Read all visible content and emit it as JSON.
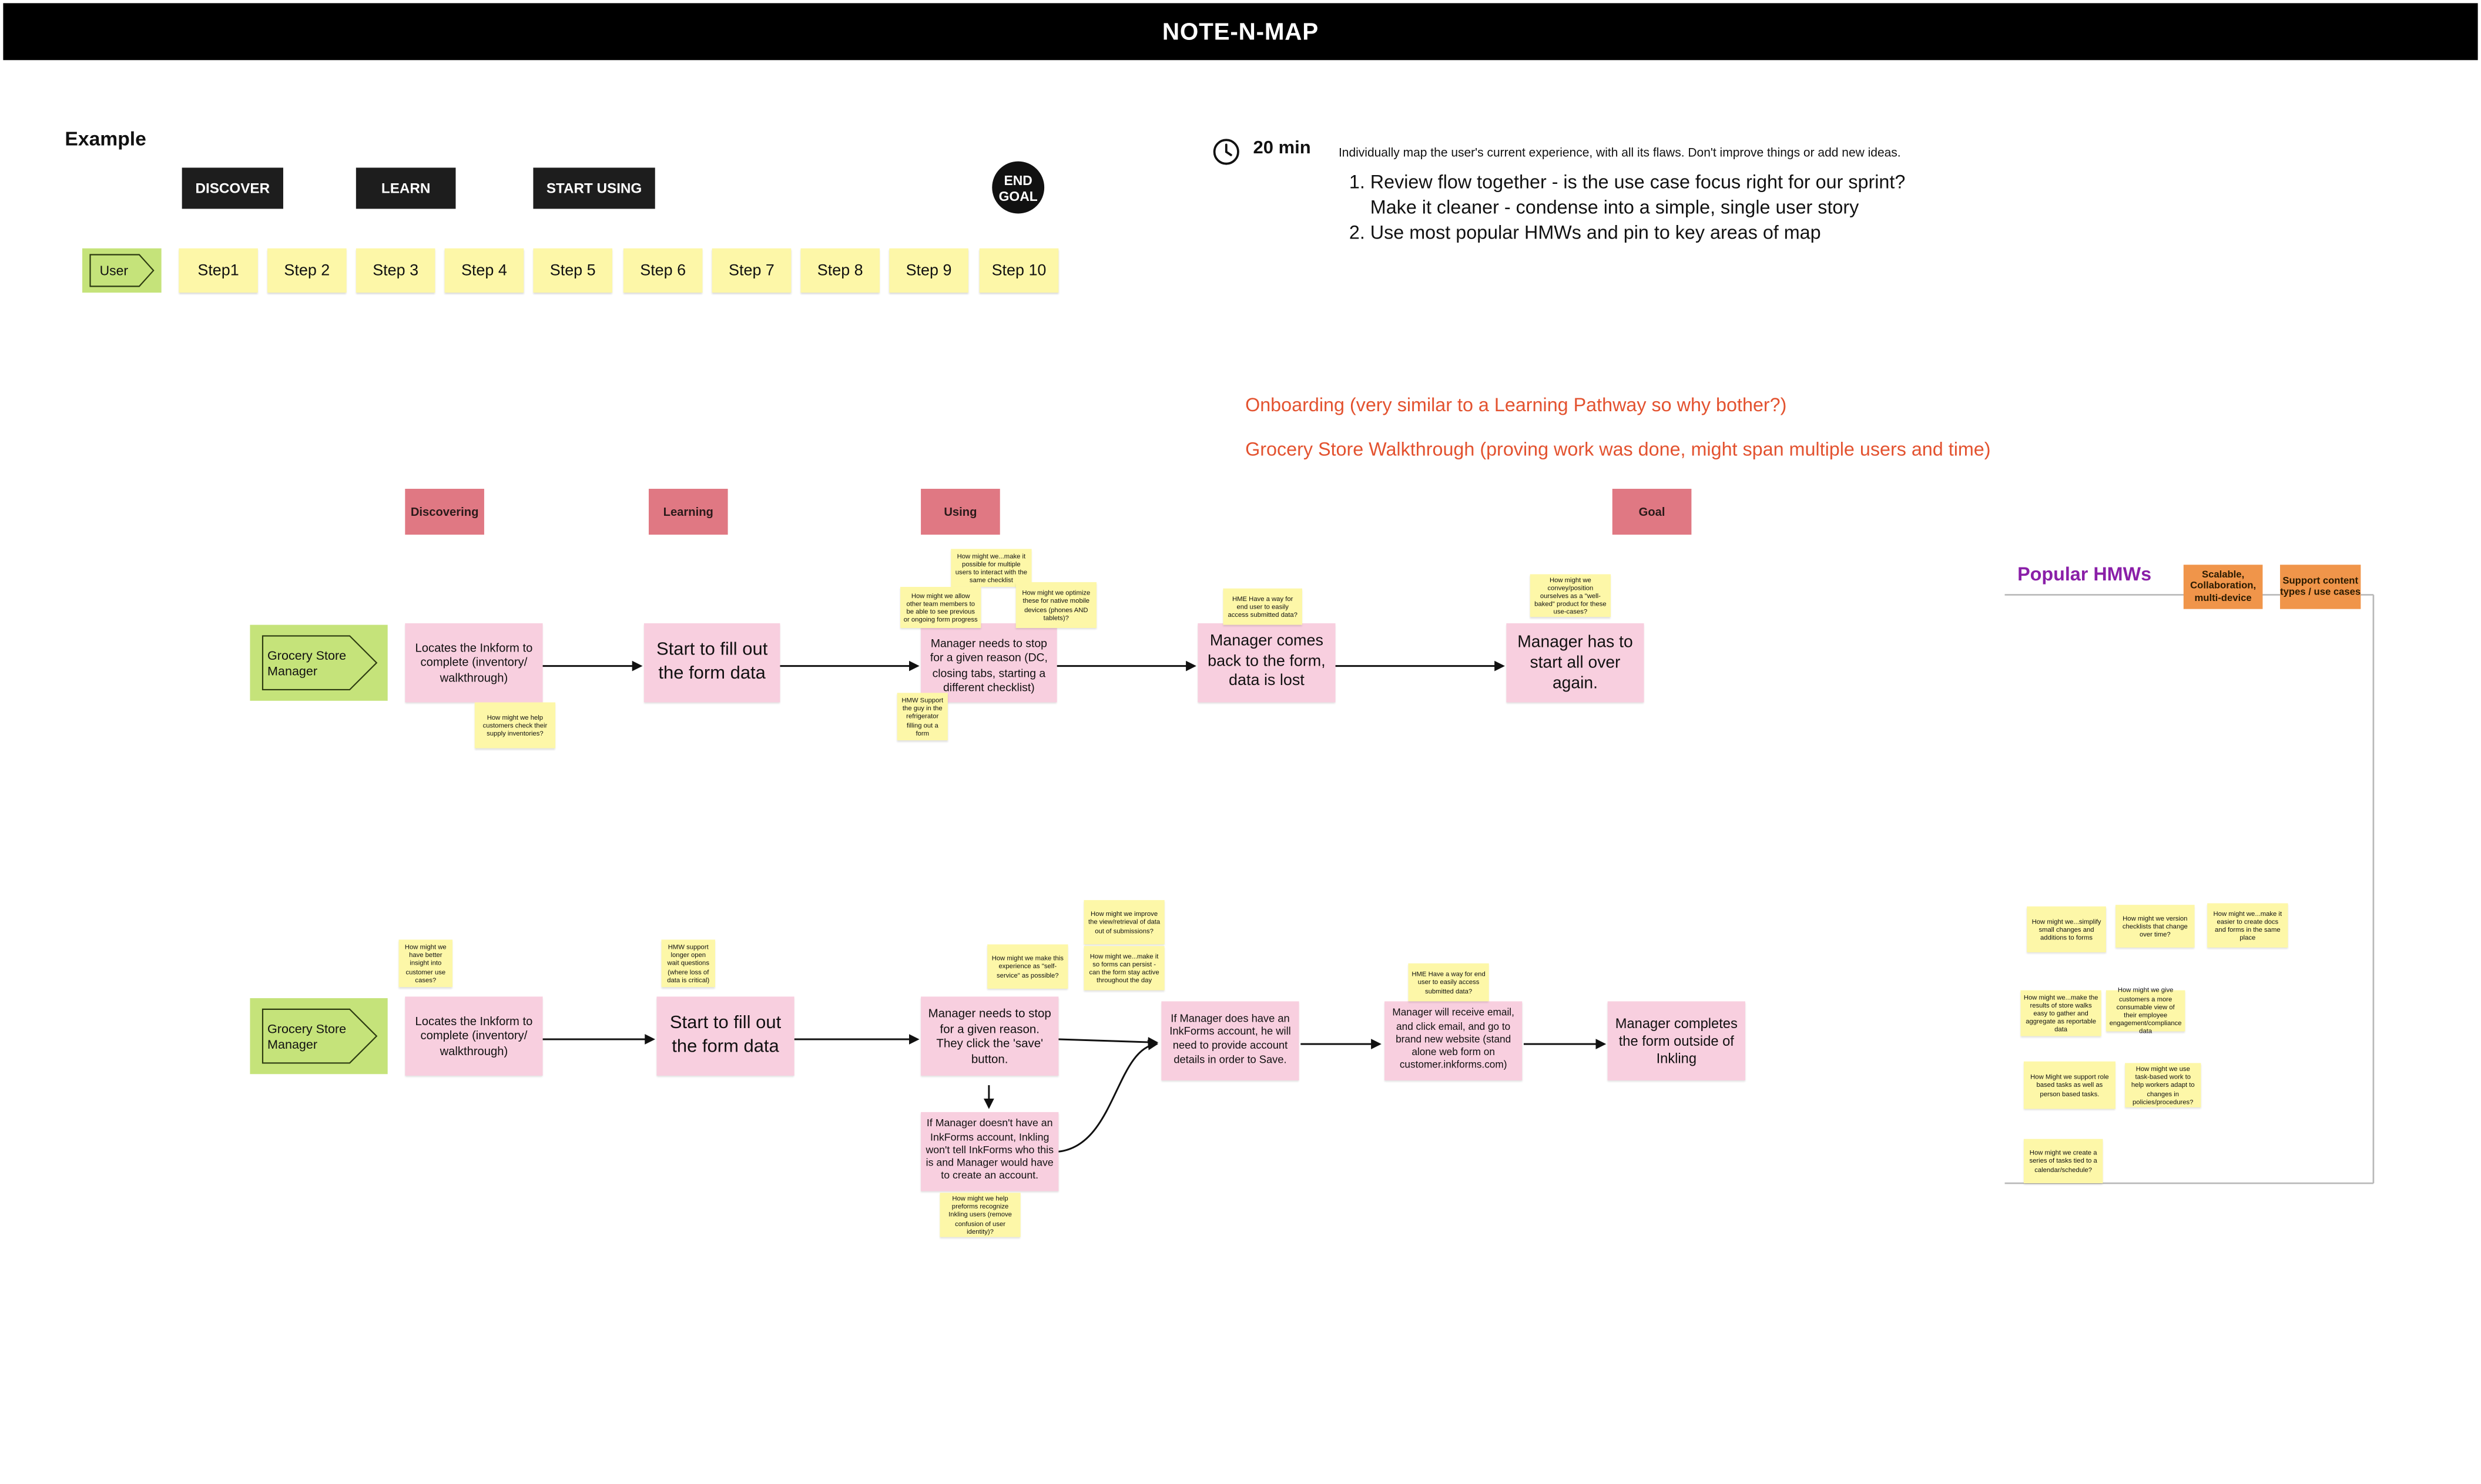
{
  "header": {
    "title": "NOTE-N-MAP"
  },
  "example": {
    "label": "Example",
    "phases": [
      "DISCOVER",
      "LEARN",
      "START USING"
    ],
    "end_goal_line1": "END",
    "end_goal_line2": "GOAL",
    "user_label": "User",
    "steps": [
      "Step1",
      "Step 2",
      "Step 3",
      "Step 4",
      "Step 5",
      "Step 6",
      "Step 7",
      "Step 8",
      "Step 9",
      "Step 10"
    ]
  },
  "instructions": {
    "time": "20 min",
    "summary": "Individually map the user's current experience, with all its flaws. Don't improve things or add new ideas.",
    "item1_line1": "Review flow together - is the use case focus right for our sprint?",
    "item1_line2": "Make it cleaner - condense into a simple, single user story",
    "item2": "Use most popular HMWs and pin to key areas of map"
  },
  "notes": {
    "onboarding": "Onboarding (very similar to a Learning Pathway so why bother?)",
    "walkthrough": "Grocery Store Walkthrough (proving work was done, might span multiple users and time)"
  },
  "stages": [
    "Discovering",
    "Learning",
    "Using",
    "Goal"
  ],
  "row1": {
    "persona": "Grocery Store Manager",
    "boxes": [
      "Locates the Inkform to complete (inventory/ walkthrough)",
      "Start to fill out the form data",
      "Manager needs to stop for a given reason (DC, closing tabs, starting a different checklist)",
      "Manager comes back to the form, data is lost",
      "Manager has to start all over again."
    ],
    "stickies": [
      "How might we help customers check their supply inventories?",
      "How might we...make it possible for multiple users to interact with the same checklist",
      "How might we allow other team members to be able to see previous or ongoing form progress",
      "How might we optimize these for native mobile devices (phones AND tablets)?",
      "HMW Support the guy in the refrigerator filling out a form",
      "HME Have a way for end user to easily access submitted data?",
      "How might we convey/position ourselves as a \"well-baked\" product for these use-cases?"
    ]
  },
  "row2": {
    "persona": "Grocery Store Manager",
    "boxes": [
      "Locates the Inkform to complete (inventory/ walkthrough)",
      "Start to fill out the form data",
      "Manager needs to stop for a given reason. They click the 'save' button.",
      "If Manager doesn't have an InkForms account, Inkling won't tell InkForms who this is and Manager would have to create an account.",
      "If Manager does have an InkForms account, he will need to provide account details in order to Save.",
      "Manager will receive email, and click email, and go to brand new website (stand alone web form on customer.inkforms.com)",
      "Manager completes the form outside of Inkling"
    ],
    "stickies": [
      "How might we have better insight into customer use cases?",
      "HMW support longer open wait questions (where loss of data is critical)",
      "How might we make this experience as \"self-service\" as possible?",
      "How might we improve the view/retrieval of data out of submissions?",
      "How might we...make it so forms can persist - can the form stay active throughout the day",
      "How might we help preforms recognize Inkling users (remove confusion of user identity)?",
      "HME Have a way for end user to easily access submitted data?"
    ]
  },
  "popular": {
    "title": "Popular HMWs",
    "tag1": "Scalable, Collaboration, multi-device",
    "tag2": "Support content types / use cases",
    "stickies": [
      "How might we...simplify small changes and additions to forms",
      "How might we version checklists that change over time?",
      "How might we...make it easier to create docs and forms in the same place",
      "How might we...make the results of store walks easy to gather and aggregate as reportable data",
      "How might we give customers a more consumable view of their employee engagement/compliance data",
      "How Might we support role based tasks as well as person based tasks.",
      "How might we use task-based work to help workers adapt to changes in policies/procedures?",
      "How might we create a series of tasks tied to a calendar/schedule?"
    ]
  }
}
